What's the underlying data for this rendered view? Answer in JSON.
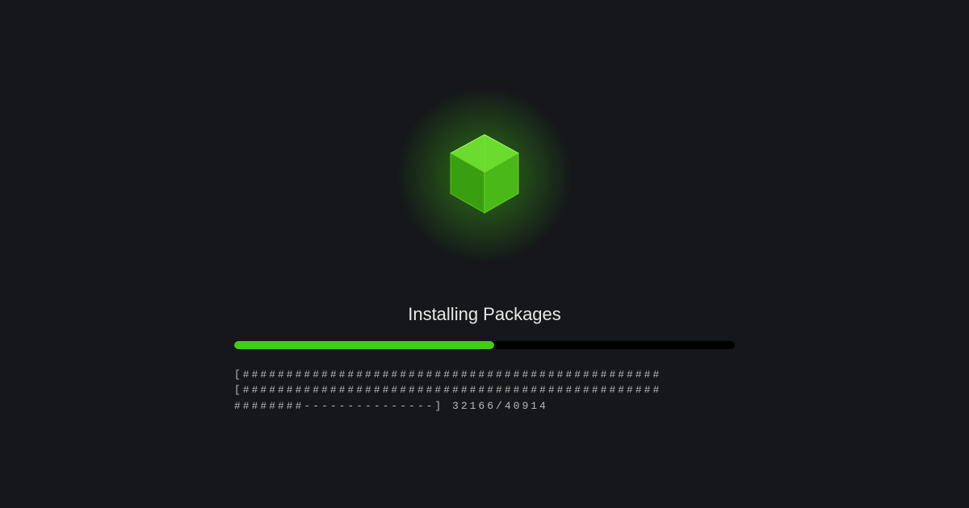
{
  "title": "Installing Packages",
  "progress": {
    "percent": 52,
    "current": 32166,
    "total": 40914,
    "ascii_line1": "[################################################",
    "ascii_line2": "[################################################",
    "ascii_line3": "########---------------] 32166/40914"
  },
  "colors": {
    "accent": "#44cc14",
    "background": "#15171a"
  }
}
